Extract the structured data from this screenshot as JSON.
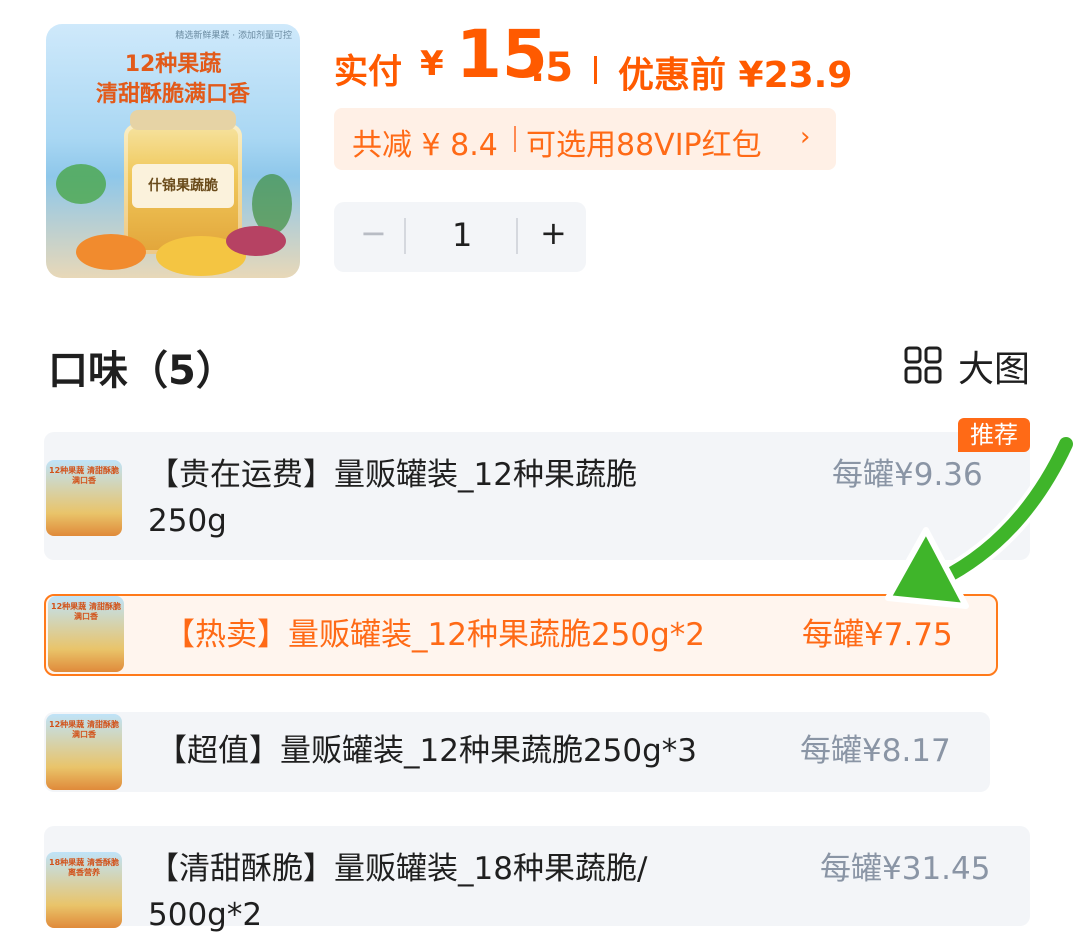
{
  "product": {
    "image_text_small": "精选新鲜果蔬 · 添加剂量可控",
    "image_text_line1": "12种果蔬",
    "image_text_line2": "清甜酥脆满口香",
    "image_jar_label": "什锦果蔬脆"
  },
  "price": {
    "pay_label": "实付",
    "currency": "¥",
    "pay_integer": "15",
    "pay_decimal": ".5",
    "original_text": "优惠前 ¥23.9"
  },
  "discount": {
    "total_text": "共减 ¥ 8.4",
    "vip_text": "可选用88VIP红包",
    "arrow": "›"
  },
  "quantity": {
    "minus": "−",
    "value": "1",
    "plus": "+"
  },
  "section": {
    "title": "口味（5）",
    "view_label": "大图"
  },
  "options": [
    {
      "tag": "【贵在运费】",
      "name_line1": "量贩罐装_12种果蔬脆",
      "name_line2": "250g",
      "price": "每罐¥9.36",
      "badge": "推荐",
      "thumb_text": "12种果蔬 清甜酥脆满口香"
    },
    {
      "tag": "【热卖】",
      "name_line1": "量贩罐装_12种果蔬脆250g*2",
      "price": "每罐¥7.75",
      "thumb_text": "12种果蔬 清甜酥脆满口香"
    },
    {
      "tag": "【超值】",
      "name_line1": "量贩罐装_12种果蔬脆250g*3",
      "price": "每罐¥8.17",
      "thumb_text": "12种果蔬 清甜酥脆满口香"
    },
    {
      "tag": "【清甜酥脆】",
      "name_line1": "量贩罐装_18种果蔬脆/",
      "name_line2": "500g*2",
      "price": "每罐¥31.45",
      "thumb_text": "18种果蔬 清香酥脆 离香营养"
    }
  ]
}
